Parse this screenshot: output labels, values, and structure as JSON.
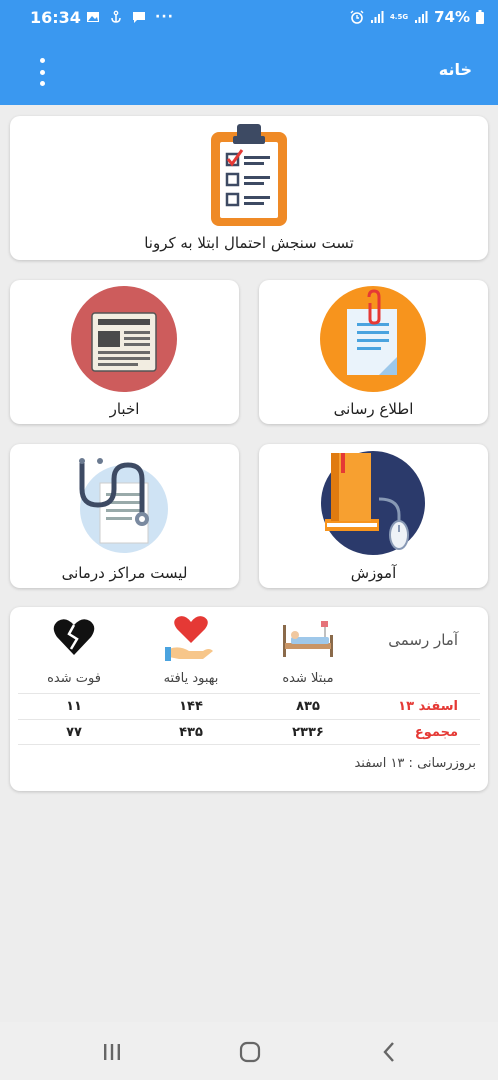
{
  "status_bar": {
    "time": "16:34",
    "network": "4.5G",
    "battery": "74%"
  },
  "app_bar": {
    "title": "خانه"
  },
  "cards": {
    "test_label": "تست سنجش احتمال ابتلا به کرونا",
    "news_label": "اخبار",
    "info_label": "اطلاع رسانی",
    "centers_label": "لیست مراکز درمانی",
    "education_label": "آموزش"
  },
  "stats": {
    "title": "آمار رسمی",
    "columns": {
      "infected": "مبتلا شده",
      "recovered": "بهبود یافته",
      "deaths": "فوت شده"
    },
    "rows": [
      {
        "label": "۱۳ اسفند",
        "infected": "۸۳۵",
        "recovered": "۱۴۴",
        "deaths": "۱۱"
      },
      {
        "label": "مجموع",
        "infected": "۲۳۳۶",
        "recovered": "۴۳۵",
        "deaths": "۷۷"
      }
    ],
    "updated": "بروزرسانی : ۱۳ اسفند"
  },
  "colors": {
    "primary": "#3a98f0",
    "accent_red": "#e53935"
  }
}
